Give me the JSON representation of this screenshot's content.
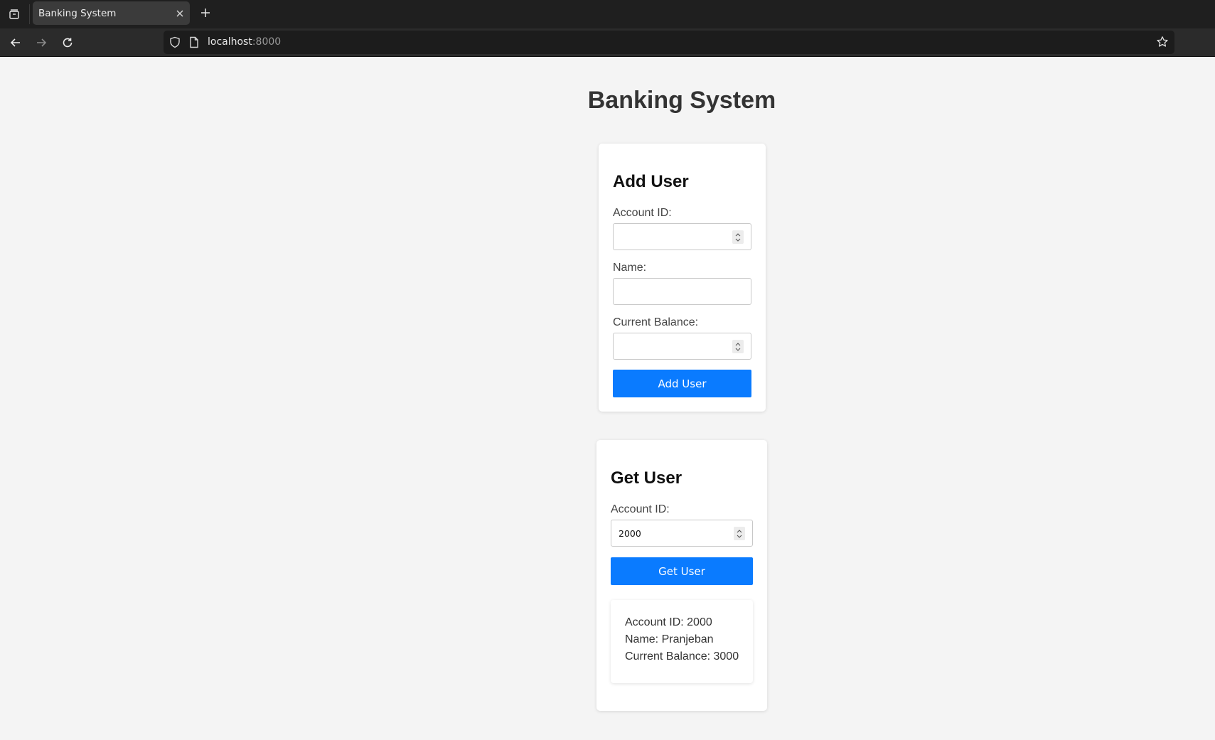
{
  "browser": {
    "tab_title": "Banking System",
    "url_host": "localhost",
    "url_port": ":8000"
  },
  "page": {
    "title": "Banking System"
  },
  "add_user": {
    "heading": "Add User",
    "account_id_label": "Account ID:",
    "account_id_value": "",
    "name_label": "Name:",
    "name_value": "",
    "balance_label": "Current Balance:",
    "balance_value": "",
    "button_label": "Add User"
  },
  "get_user": {
    "heading": "Get User",
    "account_id_label": "Account ID:",
    "account_id_value": "2000",
    "button_label": "Get User",
    "result": {
      "account_id": "Account ID: 2000",
      "name": "Name: Pranjeban",
      "balance": "Current Balance: 3000"
    }
  },
  "colors": {
    "accent": "#0a7bff",
    "page_background": "#f4f4f4",
    "card_background": "#ffffff"
  }
}
